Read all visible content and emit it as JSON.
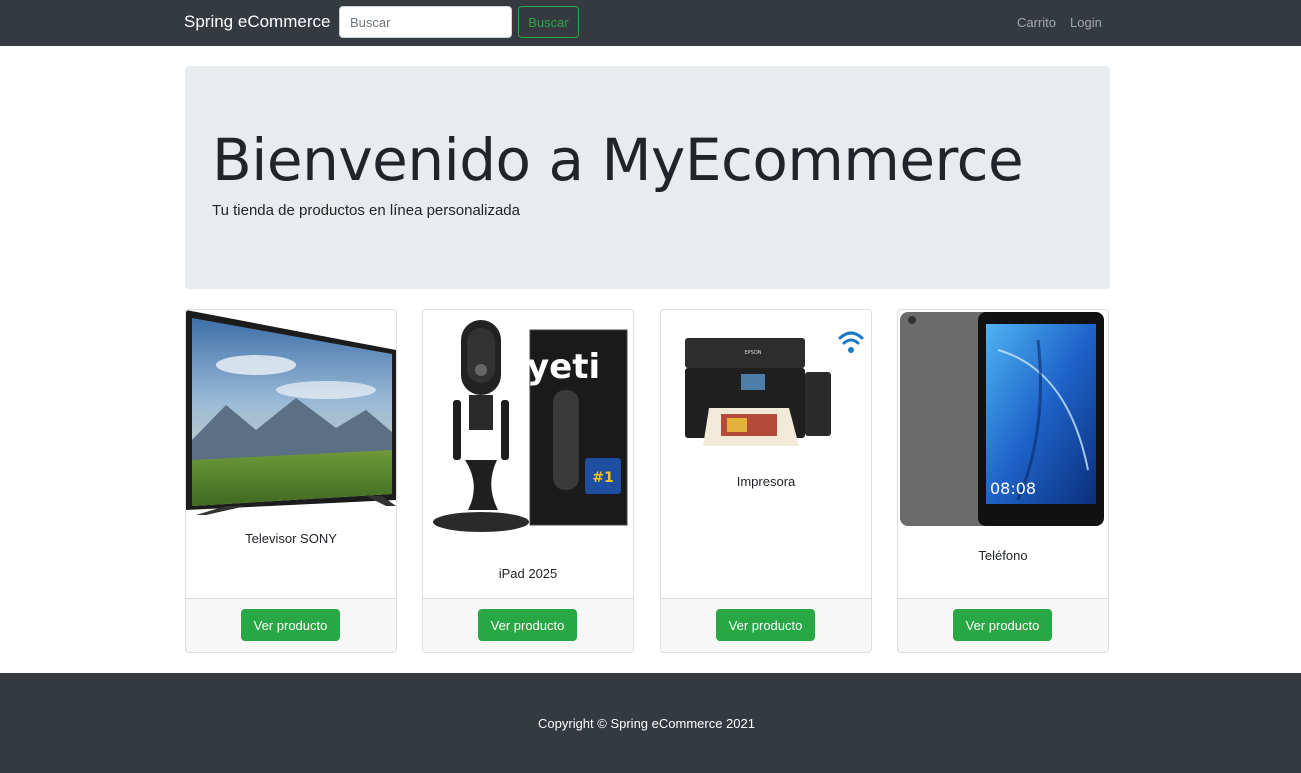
{
  "navbar": {
    "brand": "Spring eCommerce",
    "search_placeholder": "Buscar",
    "search_button": "Buscar",
    "links": [
      "Carrito",
      "Login"
    ]
  },
  "hero": {
    "title": "Bienvenido a MyEcommerce",
    "subtitle": "Tu tienda de productos en línea personalizada"
  },
  "products": [
    {
      "name": "Televisor SONY",
      "button": "Ver producto",
      "image_icon": "tv-image"
    },
    {
      "name": "iPad 2025",
      "button": "Ver producto",
      "image_icon": "microphone-image",
      "image_text": "yeti"
    },
    {
      "name": "Impresora",
      "button": "Ver producto",
      "image_icon": "printer-image",
      "image_text": "EPSON"
    },
    {
      "name": "Teléfono",
      "button": "Ver producto",
      "image_icon": "tablet-image",
      "image_text": "08:08"
    }
  ],
  "footer": {
    "copyright": "Copyright © Spring eCommerce 2021"
  },
  "colors": {
    "navbar_bg": "#343a40",
    "accent_green": "#28a745",
    "jumbotron_bg": "#e9ecef"
  }
}
